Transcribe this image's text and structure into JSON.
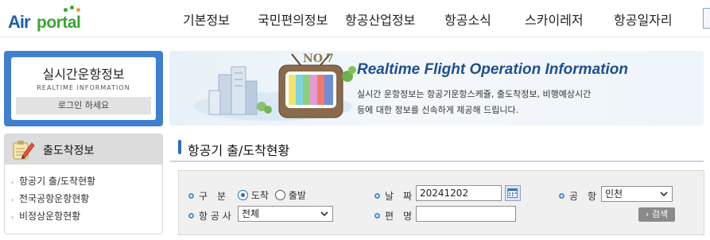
{
  "header": {
    "logo_part1": "Air",
    "logo_part2": "portal",
    "nav": [
      "기본정보",
      "국민편의정보",
      "항공산업정보",
      "항공소식",
      "스카이레저",
      "항공일자리"
    ]
  },
  "sidebar": {
    "realtime_title": "실시간운항정보",
    "realtime_subtitle": "REALTIME INFORMATION",
    "login_label": "로그인 하세요",
    "menu_title": "출도착정보",
    "menu_items": [
      "항공기 출/도착현황",
      "전국공항운항현황",
      "비정상운항현황"
    ]
  },
  "banner": {
    "title": "Realtime Flight Operation Information",
    "desc_line1": "실시간 운항정보는 항공기운항스케쥴, 출도착정보, 비행예상시간",
    "desc_line2": "등에 대한 정보를 신속하게 제공해 드립니다."
  },
  "section": {
    "title": "항공기 출/도착현황"
  },
  "form": {
    "type_label": "구　분",
    "option_arrival": "도착",
    "option_departure": "출발",
    "selected_option": "arrival",
    "date_label": "날　짜",
    "date_value": "20241202",
    "airport_label": "공　항",
    "airport_value": "인천",
    "airline_label": "항 공 사",
    "airline_value": "전체",
    "flight_label": "편　명",
    "flight_value": "",
    "search_label": "› 검색"
  },
  "colors": {
    "brand_blue": "#1f5fa9",
    "brand_green": "#3aa535",
    "accent_blue": "#2a6dc6",
    "sidebar_blue": "#3f7fd0"
  }
}
